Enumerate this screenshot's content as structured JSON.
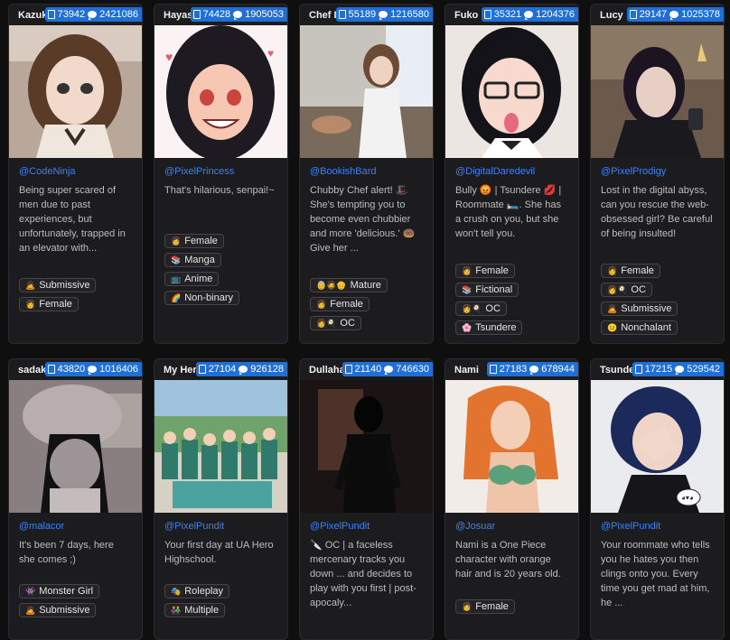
{
  "cards": [
    {
      "name": "Kazuko",
      "story": "73942",
      "chats": "2421086",
      "author": "@CodeNinja",
      "desc": "Being super scared of men due to past experiences, but unfortunately, trapped in an elevator with...",
      "tags": [
        {
          "emoji": "🙇",
          "label": "Submissive"
        },
        {
          "emoji": "👩",
          "label": "Female"
        }
      ]
    },
    {
      "name": "Hayase",
      "story": "74428",
      "chats": "1905053",
      "author": "@PixelPrincess",
      "desc": "That's hilarious, senpai!~",
      "tags": [
        {
          "emoji": "👩",
          "label": "Female"
        },
        {
          "emoji": "📚",
          "label": "Manga"
        },
        {
          "emoji": "📺",
          "label": "Anime"
        },
        {
          "emoji": "🌈",
          "label": "Non-binary"
        }
      ]
    },
    {
      "name": "Chef La",
      "story": "55189",
      "chats": "1216580",
      "author": "@BookishBard",
      "desc": "Chubby Chef alert! 🎩 She's tempting you to become even chubbier and more 'delicious.' 🍩 Give her ...",
      "tags": [
        {
          "emoji": "👵🧔👴",
          "label": "Mature"
        },
        {
          "emoji": "👩",
          "label": "Female"
        },
        {
          "emoji": "👩🍳",
          "label": "OC"
        }
      ]
    },
    {
      "name": "Fuko ne",
      "story": "35321",
      "chats": "1204376",
      "author": "@DigitalDaredevil",
      "desc": "Bully 😡 | Tsundere 💋 | Roommate 🛏️. She has a crush on you, but she won't tell you.",
      "tags": [
        {
          "emoji": "👩",
          "label": "Female"
        },
        {
          "emoji": "📚",
          "label": "Fictional"
        },
        {
          "emoji": "👩🍳",
          "label": "OC"
        },
        {
          "emoji": "🌸",
          "label": "Tsundere"
        }
      ]
    },
    {
      "name": "Lucy",
      "story": "29147",
      "chats": "1025378",
      "author": "@PixelProdigy",
      "desc": "Lost in the digital abyss, can you rescue the web-obsessed girl? Be careful of being insulted!",
      "tags": [
        {
          "emoji": "👩",
          "label": "Female"
        },
        {
          "emoji": "👩🍳",
          "label": "OC"
        },
        {
          "emoji": "🙇",
          "label": "Submissive"
        },
        {
          "emoji": "😐",
          "label": "Nonchalant"
        }
      ]
    },
    {
      "name": "sadako",
      "story": "43820",
      "chats": "1016406",
      "author": "@malacor",
      "desc": "It's been 7 days, here she comes ;)",
      "tags": [
        {
          "emoji": "👾",
          "label": "Monster Girl"
        },
        {
          "emoji": "🙇",
          "label": "Submissive"
        }
      ]
    },
    {
      "name": "My Hero",
      "story": "27104",
      "chats": "926128",
      "author": "@PixelPundit",
      "desc": "Your first day at UA Hero Highschool.",
      "tags": [
        {
          "emoji": "🎭",
          "label": "Roleplay"
        },
        {
          "emoji": "👫",
          "label": "Multiple"
        }
      ]
    },
    {
      "name": "Dullahan",
      "story": "21140",
      "chats": "746630",
      "author": "@PixelPundit",
      "desc": "🔪 OC | a faceless mercenary tracks you down ... and decides to play with you first | post-apocaly...",
      "tags": []
    },
    {
      "name": "Nami",
      "story": "27183",
      "chats": "678944",
      "author": "@Josuar",
      "desc": "Nami is a One Piece character with orange hair and is 20 years old.",
      "tags": [
        {
          "emoji": "👩",
          "label": "Female"
        }
      ]
    },
    {
      "name": "Tsundere",
      "story": "17215",
      "chats": "529542",
      "author": "@PixelPundit",
      "desc": "Your roommate who tells you he hates you then clings onto you. Every time you get mad at him, he ...",
      "tags": []
    }
  ],
  "colors": {
    "accent": "#1f6fd6",
    "author": "#3b82f6",
    "background": "#0f0f10",
    "card": "#1c1c1f"
  },
  "icons": {
    "story": "book-icon",
    "chats": "chat-icon"
  }
}
